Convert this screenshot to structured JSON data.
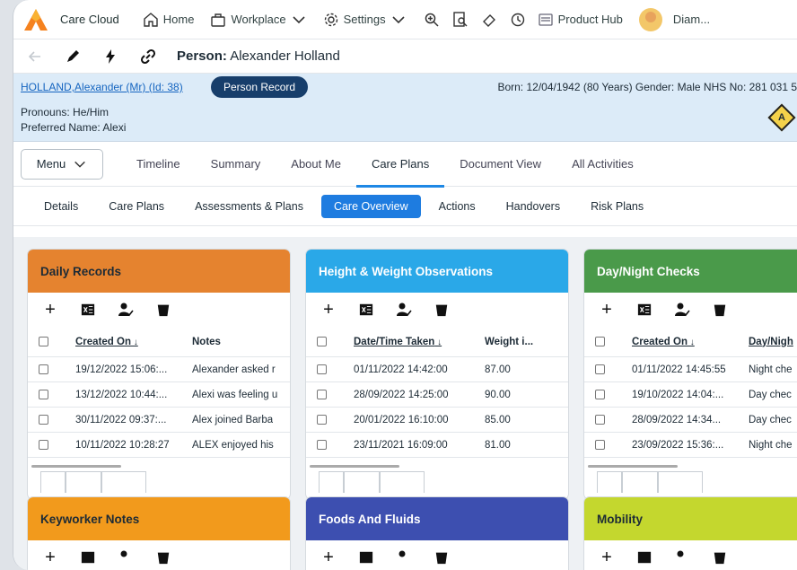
{
  "topbar": {
    "app_name": "Care Cloud",
    "home": "Home",
    "workplace": "Workplace",
    "settings": "Settings",
    "product_hub": "Product Hub",
    "user": "Diam..."
  },
  "toolbar": {
    "title_prefix": "Person:",
    "title_name": "Alexander Holland"
  },
  "banner": {
    "link": "HOLLAND,Alexander (Mr) (Id: 38)",
    "record_button": "Person Record",
    "born": "Born: 12/04/1942 (80 Years)  Gender: Male  NHS No: 281 031 5",
    "pronouns": "Pronouns: He/Him",
    "preferred": "Preferred Name: Alexi",
    "alert_letter": "A"
  },
  "tabs": {
    "menu": "Menu",
    "items": [
      "Timeline",
      "Summary",
      "About Me",
      "Care Plans",
      "Document View",
      "All Activities"
    ],
    "active": "Care Plans"
  },
  "subtabs": {
    "items": [
      "Details",
      "Care Plans",
      "Assessments & Plans",
      "Care Overview",
      "Actions",
      "Handovers",
      "Risk Plans"
    ],
    "active": "Care Overview"
  },
  "colors": {
    "daily": "#e5832f",
    "height": "#2aa8e8",
    "daynight": "#4a9a4a",
    "keyworker": "#f29a1c",
    "foods": "#3d4fb0",
    "mobility": "#c4d72e"
  },
  "cards": {
    "daily": {
      "title": "Daily Records",
      "col1": "Created On",
      "col2": "Notes",
      "rows": [
        [
          "19/12/2022 15:06:...",
          "Alexander asked r"
        ],
        [
          "13/12/2022 10:44:...",
          "Alexi was feeling u"
        ],
        [
          "30/11/2022 09:37:...",
          "Alex joined Barba"
        ],
        [
          "10/11/2022 10:28:27",
          "ALEX enjoyed his"
        ]
      ]
    },
    "height": {
      "title": "Height & Weight Observations",
      "col1": "Date/Time Taken",
      "col2": "Weight i...",
      "rows": [
        [
          "01/11/2022 14:42:00",
          "87.00"
        ],
        [
          "28/09/2022 14:25:00",
          "90.00"
        ],
        [
          "20/01/2022 16:10:00",
          "85.00"
        ],
        [
          "23/11/2021 16:09:00",
          "81.00"
        ]
      ]
    },
    "daynight": {
      "title": "Day/Night Checks",
      "col1": "Created On",
      "col2": "Day/Nigh",
      "rows": [
        [
          "01/11/2022 14:45:55",
          "Night che"
        ],
        [
          "19/10/2022 14:04:...",
          "Day chec"
        ],
        [
          "28/09/2022 14:34...",
          "Day chec"
        ],
        [
          "23/09/2022 15:36:...",
          "Night che"
        ]
      ]
    },
    "keyworker": {
      "title": "Keyworker Notes"
    },
    "foods": {
      "title": "Foods And Fluids"
    },
    "mobility": {
      "title": "Mobility"
    }
  }
}
